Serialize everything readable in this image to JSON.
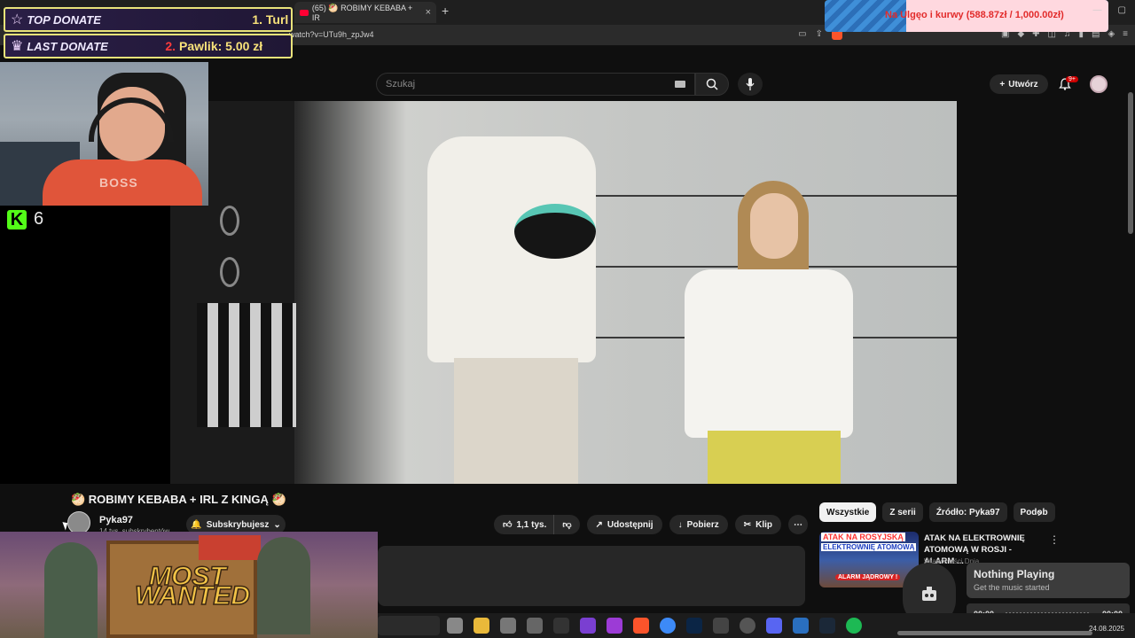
{
  "browser": {
    "tab_title": "(65) 🥙 ROBIMY KEBABA + IR",
    "url": "watch?v=UTu9h_zpJw4",
    "new_tab": "+",
    "close": "×"
  },
  "overlay": {
    "top_donate_label": "TOP DONATE",
    "top_donate_value": "1. Turl",
    "last_donate_label": "LAST DONATE",
    "last_donate_rank": "2.",
    "last_donate_value": "Pawlik: 5.00 zł",
    "goal_text": "Na Ulgęo i kurwy (588.87zł / 1,000.00zł)",
    "goal_progress": 0.589,
    "kick_logo": "K",
    "kick_viewers": "6",
    "webcam_shirt_text": "BOSS"
  },
  "youtube": {
    "search_placeholder": "Szukaj",
    "create_label": "Utwórz",
    "notif_badge": "9+",
    "video_title": "🥙 ROBIMY KEBABA + IRL Z KINGĄ 🥙",
    "channel_name": "Pyka97",
    "channel_subs": "14 tys. subskrybentów",
    "subscribe_label": "Subskrybujesz",
    "likes": "1,1 tys.",
    "share_label": "Udostępnij",
    "download_label": "Pobierz",
    "clip_label": "Klip",
    "chips": [
      "Wszystkie",
      "Z serii",
      "Źródło: Pyka97",
      "Podob"
    ],
    "rec_thumb_line1": "ATAK NA ROSYJSKĄ",
    "rec_thumb_line2": "ELEKTROWNIĘ ATOMOWĄ",
    "rec_thumb_line3": "ALARM JĄDROWY !",
    "rec_title": "ATAK NA ELEKTROWNIĘ ATOMOWĄ W ROSJI - ALARM ...",
    "rec_channel": "Wiadomości Dnia"
  },
  "game": {
    "title_line1": "MOST",
    "title_line2": "WANTED"
  },
  "music": {
    "status": "Nothing Playing",
    "sub": "Get the music started",
    "time_start": "00:00",
    "time_end": "00:00"
  },
  "taskbar": {
    "date": "24.08.2025"
  },
  "colors": {
    "yt_bg": "#0f0f0f",
    "kick_green": "#53fc18",
    "donate_gold": "#f8e27a",
    "yt_red": "#ff0033"
  }
}
